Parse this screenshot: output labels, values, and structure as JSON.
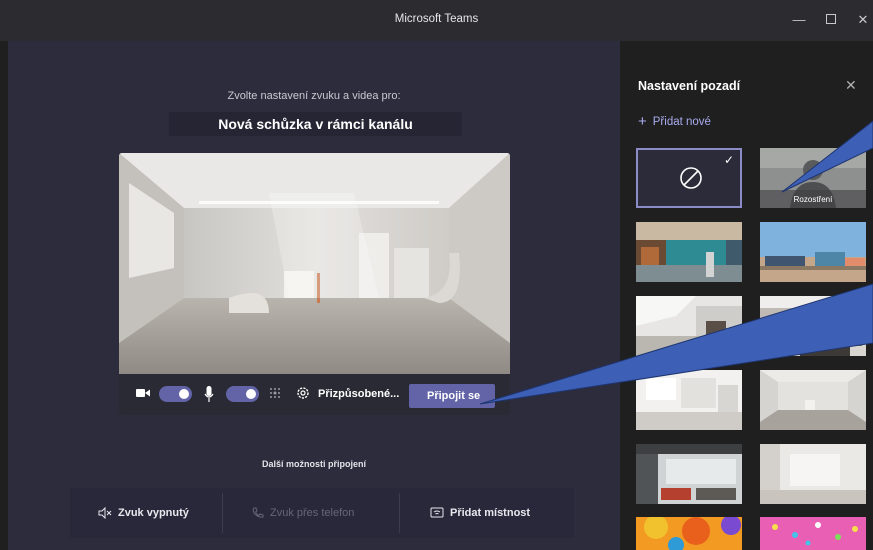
{
  "window": {
    "title": "Microsoft Teams",
    "minimize_glyph": "—",
    "close_glyph": "✕"
  },
  "prejoin": {
    "prompt": "Zvolte nastavení zvuku a videa pro:",
    "meeting_title": "Nová schůzka v rámci kanálu",
    "camera_on": true,
    "mic_on": true,
    "custom_setup_label": "Přizpůsobené...",
    "join_label": "Připojit se",
    "more_options_label": "Další možnosti připojení",
    "options": [
      {
        "label": "Zvuk vypnutý",
        "icon": "speaker-off-icon",
        "enabled": true
      },
      {
        "label": "Zvuk přes telefon",
        "icon": "phone-icon",
        "enabled": false
      },
      {
        "label": "Přidat místnost",
        "icon": "cast-icon",
        "enabled": true
      }
    ]
  },
  "background_panel": {
    "title": "Nastavení pozadí",
    "close_glyph": "✕",
    "add_new_label": "Přidat nové",
    "add_new_glyph": "+",
    "selected_check": "✓",
    "blur_label": "Rozostření",
    "items": [
      "none",
      "blur",
      "office-teal",
      "beach-vehicles",
      "white-loft",
      "modern-office",
      "white-gallery",
      "white-room",
      "glass-office",
      "white-space",
      "orange-balloons",
      "pink-confetti"
    ]
  },
  "colors": {
    "accent": "#6264a7",
    "selection_border": "#8b8cc7",
    "link": "#a9acef",
    "callout": "#3d5fb5"
  }
}
